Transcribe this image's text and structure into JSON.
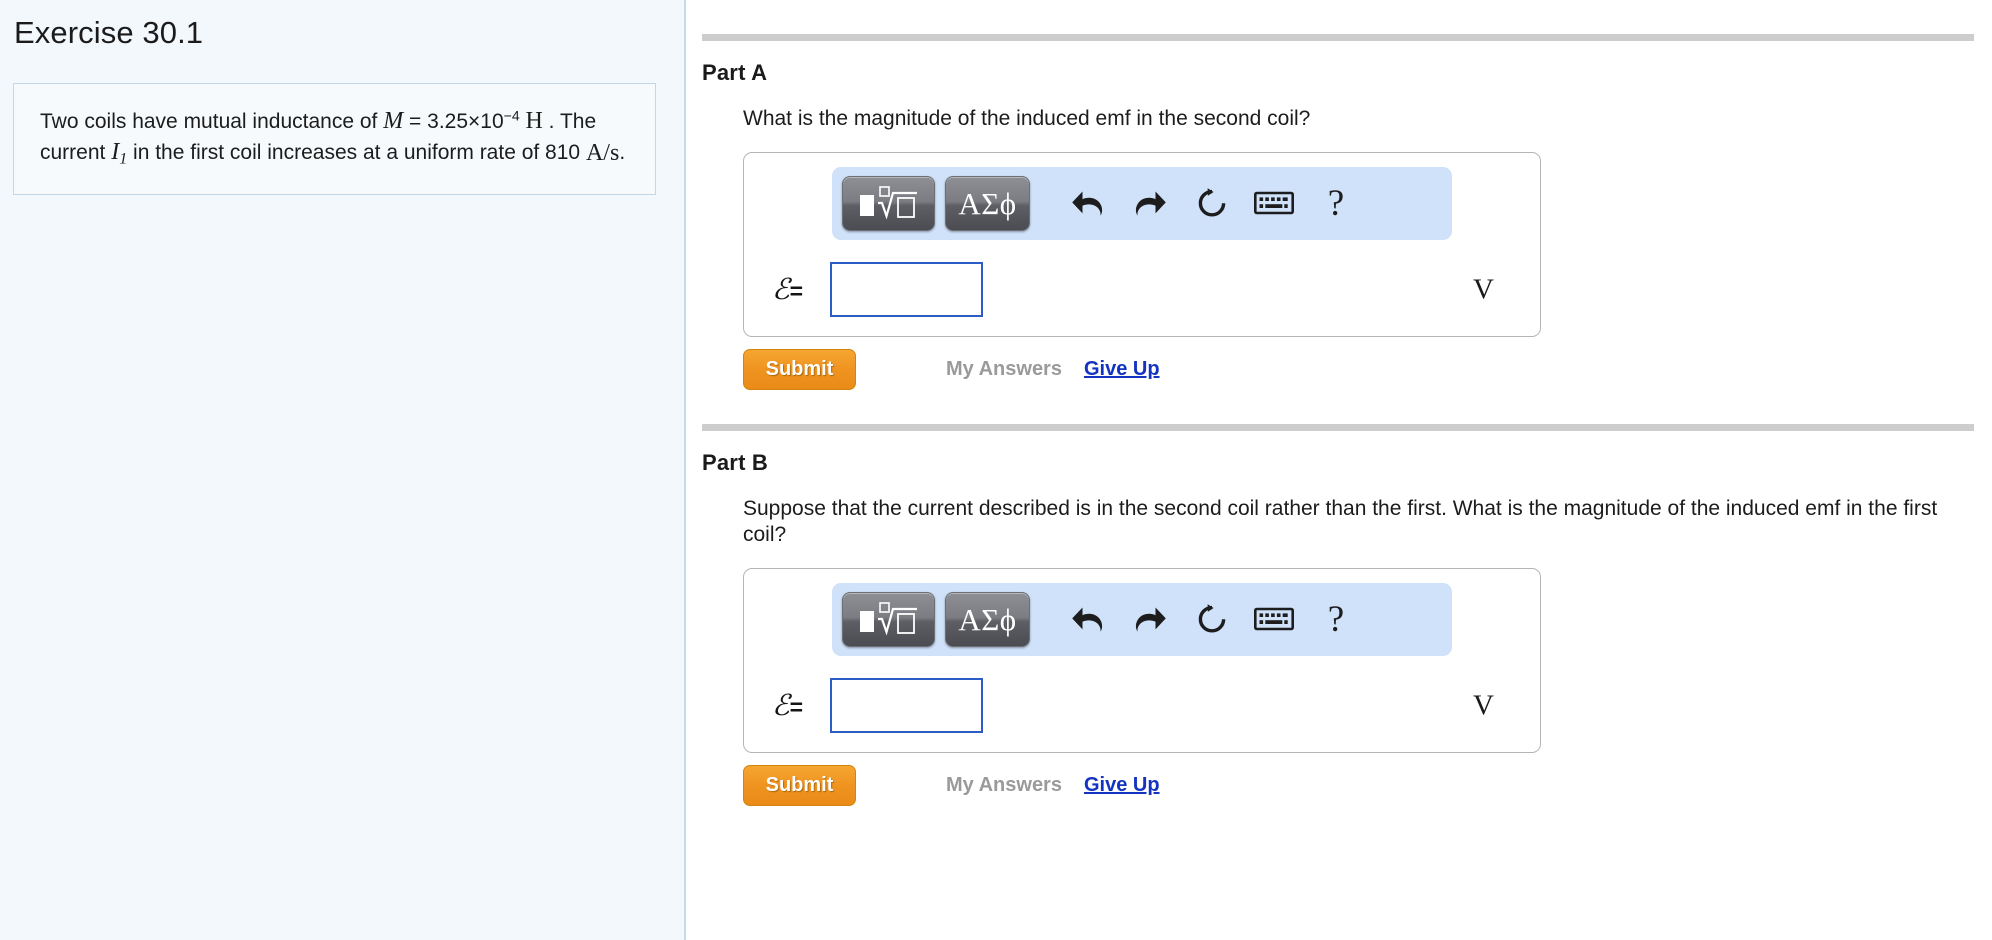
{
  "exercise": {
    "title": "Exercise 30.1",
    "problem": {
      "lead": "Two coils have mutual inductance of",
      "symbol_M": "M",
      "eq1": "=",
      "value_mantissa": "3.25×10",
      "value_exponent": "−4",
      "unit_H": "H",
      "mid": ". The current",
      "symbol_I": "I",
      "symbol_I_sub": "1",
      "tail": "in the first coil increases at a uniform rate of 810",
      "unit_rate_num": "A",
      "unit_rate_slash": "/",
      "unit_rate_den": "s",
      "period": "."
    }
  },
  "parts": [
    {
      "id": "a",
      "title": "Part A",
      "question": "What is the magnitude of the induced emf in the second coil?",
      "toolbar": {
        "template_button": "math-template",
        "greek_button": "ΑΣϕ",
        "undo": "undo",
        "redo": "redo",
        "reset": "reset",
        "keyboard": "keyboard",
        "help": "?"
      },
      "answer": {
        "symbol": "ℰ",
        "equals": "=",
        "value": "",
        "placeholder": "",
        "unit": "V"
      },
      "actions": {
        "submit": "Submit",
        "my_answers": "My Answers",
        "give_up": "Give Up"
      }
    },
    {
      "id": "b",
      "title": "Part B",
      "question": "Suppose that the current described is in the second coil rather than the first. What is the magnitude of the induced emf in the first coil?",
      "toolbar": {
        "template_button": "math-template",
        "greek_button": "ΑΣϕ",
        "undo": "undo",
        "redo": "redo",
        "reset": "reset",
        "keyboard": "keyboard",
        "help": "?"
      },
      "answer": {
        "symbol": "ℰ",
        "equals": "=",
        "value": "",
        "placeholder": "",
        "unit": "V"
      },
      "actions": {
        "submit": "Submit",
        "my_answers": "My Answers",
        "give_up": "Give Up"
      }
    }
  ],
  "colors": {
    "left_pane_bg": "#f3f8fd",
    "left_pane_border": "#c6d9ea",
    "toolbar_bg": "#cfe2fa",
    "input_border": "#2c5cc5",
    "submit_orange": "#ef9320",
    "link_blue": "#1433c2",
    "disabled_gray": "#9a9a9a",
    "rule_gray": "#cdcdcd"
  }
}
